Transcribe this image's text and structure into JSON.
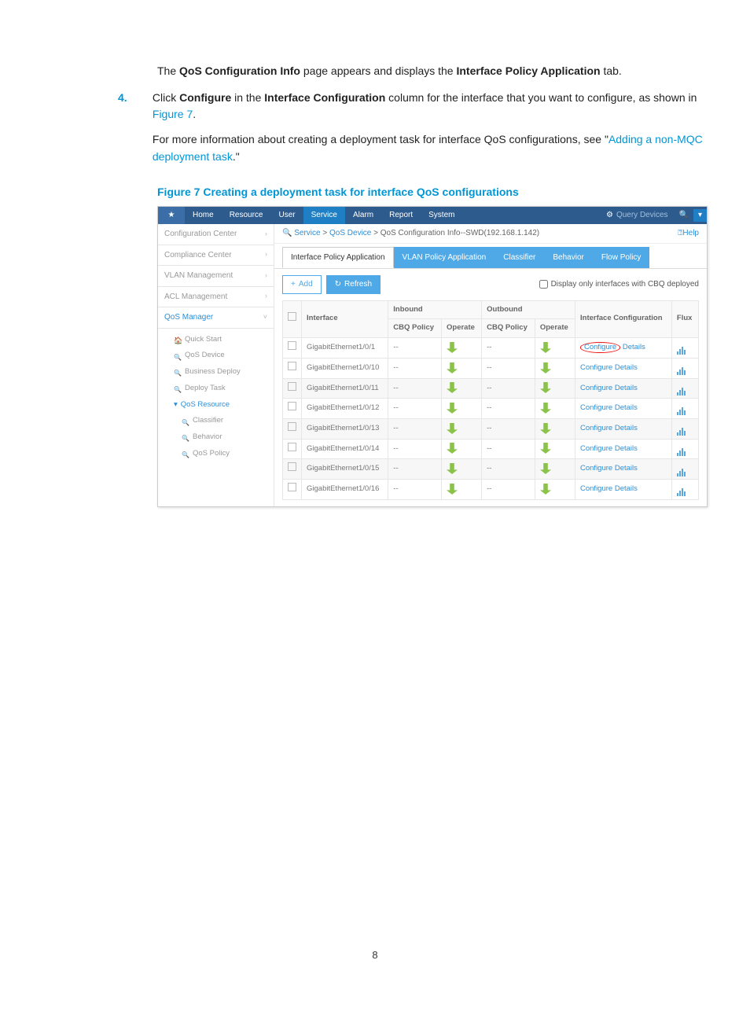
{
  "intro": {
    "line1_pre": "The ",
    "line1_b1": "QoS Configuration Info",
    "line1_mid": " page appears and displays the ",
    "line1_b2": "Interface Policy Application",
    "line1_post": " tab."
  },
  "step": {
    "num": "4.",
    "p1_pre": "Click ",
    "p1_b1": "Configure",
    "p1_mid1": " in the ",
    "p1_b2": "Interface Configuration",
    "p1_mid2": " column for the interface that you want to configure, as shown in ",
    "p1_link": "Figure 7",
    "p1_post": ".",
    "p2_pre": "For more information about creating a deployment task for interface QoS configurations, see \"",
    "p2_link": "Adding a non-MQC deployment task",
    "p2_post": ".\""
  },
  "figure_title": "Figure 7 Creating a deployment task for interface QoS configurations",
  "topnav": {
    "items": [
      "Home",
      "Resource",
      "User",
      "Service",
      "Alarm",
      "Report",
      "System"
    ],
    "active": "Service",
    "query_placeholder": "Query Devices"
  },
  "sidebar": {
    "items": [
      {
        "label": "Configuration Center"
      },
      {
        "label": "Compliance Center"
      },
      {
        "label": "VLAN Management"
      },
      {
        "label": "ACL Management"
      },
      {
        "label": "QoS Manager",
        "active": true
      }
    ],
    "tree": {
      "quick_start": "Quick Start",
      "qos_device": "QoS Device",
      "business_deploy": "Business Deploy",
      "deploy_task": "Deploy Task",
      "qos_resource": "QoS Resource",
      "classifier": "Classifier",
      "behavior": "Behavior",
      "qos_policy": "QoS Policy"
    }
  },
  "breadcrumb": {
    "glass": "🔍",
    "parts": [
      "Service",
      " > ",
      "QoS Device",
      " > ",
      "QoS Configuration Info",
      "--SWD(192.168.1.142)"
    ],
    "help": "⍰Help"
  },
  "tabs": [
    "Interface Policy Application",
    "VLAN Policy Application",
    "Classifier",
    "Behavior",
    "Flow Policy"
  ],
  "active_tab": "Interface Policy Application",
  "buttons": {
    "add": "Add",
    "refresh": "Refresh",
    "add_sym": "+",
    "ref_sym": "↻"
  },
  "display_checkbox": "Display only interfaces with CBQ deployed",
  "table": {
    "head": {
      "interface": "Interface",
      "inbound": "Inbound",
      "outbound": "Outbound",
      "cbq": "CBQ Policy",
      "operate": "Operate",
      "ifcfg": "Interface Configuration",
      "flux": "Flux"
    },
    "rows": [
      {
        "if": "GigabitEthernet1/0/1",
        "in": "--",
        "out": "--",
        "hl": true
      },
      {
        "if": "GigabitEthernet1/0/10",
        "in": "--",
        "out": "--"
      },
      {
        "if": "GigabitEthernet1/0/11",
        "in": "--",
        "out": "--",
        "alt": true
      },
      {
        "if": "GigabitEthernet1/0/12",
        "in": "--",
        "out": "--"
      },
      {
        "if": "GigabitEthernet1/0/13",
        "in": "--",
        "out": "--",
        "alt": true
      },
      {
        "if": "GigabitEthernet1/0/14",
        "in": "--",
        "out": "--"
      },
      {
        "if": "GigabitEthernet1/0/15",
        "in": "--",
        "out": "--",
        "alt": true
      },
      {
        "if": "GigabitEthernet1/0/16",
        "in": "--",
        "out": "--"
      }
    ],
    "configure": "Configure",
    "details": "Details"
  },
  "page_number": "8"
}
